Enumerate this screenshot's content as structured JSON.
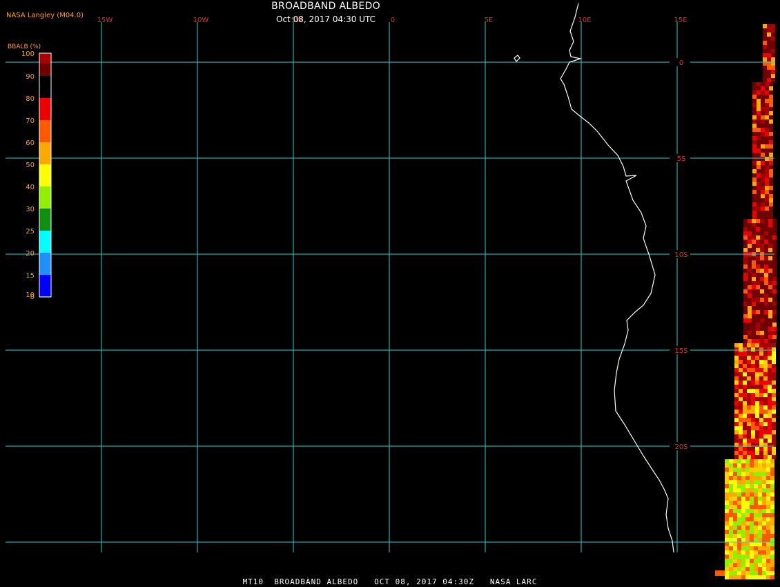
{
  "header": {
    "credit": "NASA Langley (M04.0)",
    "title": "BROADBAND ALBEDO",
    "subtitle": "Oct 08, 2017 04:30 UTC"
  },
  "footer": {
    "text": "MT10  BROADBAND ALBEDO   OCT 08, 2017 04:30Z   NASA LARC"
  },
  "legend": {
    "title": "BBALB (%)",
    "ticks": [
      "100",
      "90",
      "80",
      "70",
      "60",
      "50",
      "40",
      "30",
      "25",
      "20",
      "15",
      "10",
      "0"
    ],
    "colors": [
      "#a80000",
      "#6e0000",
      "#ee0000",
      "#ff5a00",
      "#ffa800",
      "#ffff00",
      "#90f000",
      "#109010",
      "#00ffff",
      "#1e90ff",
      "#0000ff",
      "#9030e0"
    ]
  },
  "graticule": {
    "line_color": "#30d0d0",
    "lon_labels": [
      "15W",
      "10W",
      "5W",
      "0",
      "5E",
      "10E",
      "15E"
    ],
    "lat_labels": [
      "0",
      "5S",
      "10S",
      "15S",
      "20S"
    ]
  },
  "coastline": {
    "color": "#ffffff"
  },
  "albedo_swath": {
    "palette": [
      "#6e0000",
      "#a80000",
      "#ee0000",
      "#ff5a00",
      "#ffa800",
      "#ffd000",
      "#ffff00",
      "#90f000"
    ]
  }
}
